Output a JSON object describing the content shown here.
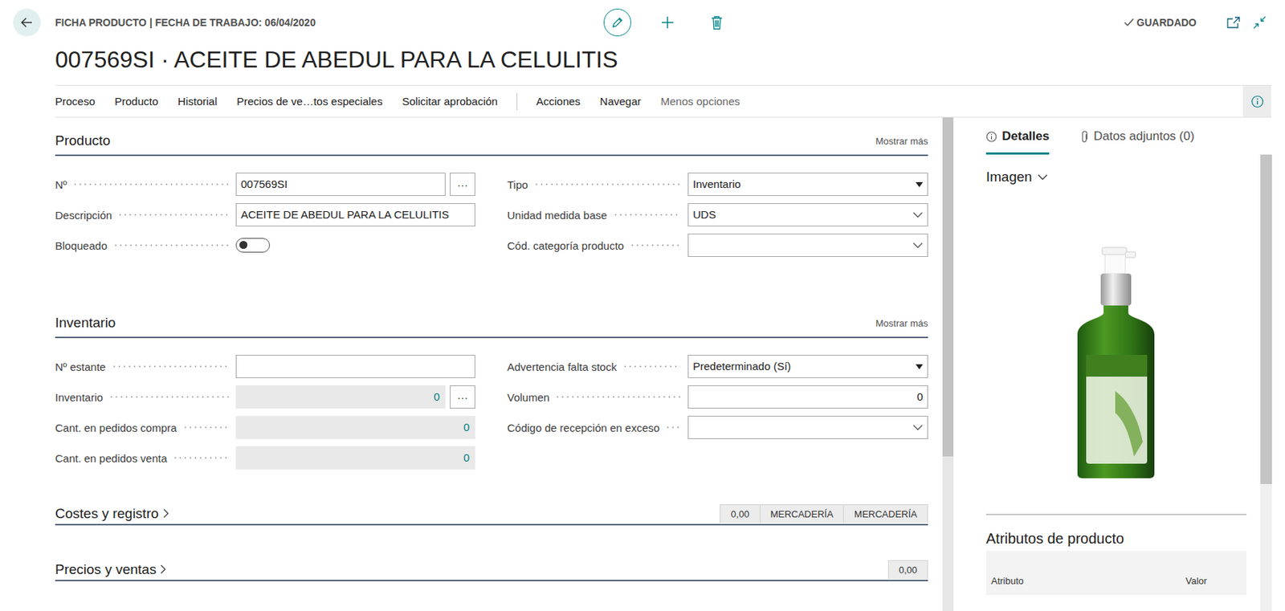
{
  "header": {
    "breadcrumb": "FICHA PRODUCTO | FECHA DE TRABAJO: 06/04/2020",
    "status": "GUARDADO"
  },
  "title": "007569SI · ACEITE DE ABEDUL PARA LA CELULITIS",
  "actions": [
    "Proceso",
    "Producto",
    "Historial",
    "Precios de ve…tos especiales",
    "Solicitar aprobación"
  ],
  "more_actions": [
    "Acciones",
    "Navegar"
  ],
  "less_options": "Menos opciones",
  "sections": [
    {
      "title": "Producto",
      "expanded": true,
      "show_more": "Mostrar más",
      "left": [
        {
          "label": "Nº",
          "kind": "lookup-text",
          "value": "007569SI",
          "button": "···"
        },
        {
          "label": "Descripción",
          "kind": "text",
          "value": "ACEITE DE ABEDUL PARA LA CELULITIS"
        },
        {
          "label": "Bloqueado",
          "kind": "toggle",
          "on": false
        }
      ],
      "right": [
        {
          "label": "Tipo",
          "kind": "select",
          "value": "Inventario"
        },
        {
          "label": "Unidad medida base",
          "kind": "combo",
          "value": "UDS"
        },
        {
          "label": "Cód. categoría producto",
          "kind": "combo",
          "value": ""
        }
      ]
    },
    {
      "title": "Inventario",
      "expanded": true,
      "show_more": "Mostrar más",
      "left": [
        {
          "label": "Nº estante",
          "kind": "text",
          "value": ""
        },
        {
          "label": "Inventario",
          "kind": "flowfield-lookup",
          "value": "0",
          "button": "···"
        },
        {
          "label": "Cant. en pedidos compra",
          "kind": "flowfield",
          "value": "0"
        },
        {
          "label": "Cant. en pedidos venta",
          "kind": "flowfield",
          "value": "0"
        }
      ],
      "right": [
        {
          "label": "Advertencia falta stock",
          "kind": "select",
          "value": "Predeterminado (Sí)"
        },
        {
          "label": "Volumen",
          "kind": "number",
          "value": "0"
        },
        {
          "label": "Código de recepción en exceso",
          "kind": "combo",
          "value": ""
        }
      ]
    },
    {
      "title": "Costes y registro",
      "expanded": false,
      "summary": [
        "0,00",
        "MERCADERÍA",
        "MERCADERÍA"
      ]
    },
    {
      "title": "Precios y ventas",
      "expanded": false,
      "summary": [
        "0,00"
      ]
    }
  ],
  "factbox": {
    "tabs": [
      {
        "label": "Detalles",
        "selected": true
      },
      {
        "label": "Datos adjuntos (0)",
        "selected": false
      }
    ],
    "image": {
      "title": "Imagen",
      "expanded": true
    },
    "attributes": {
      "title": "Atributos de producto",
      "columns": [
        "Atributo",
        "Valor"
      ]
    }
  }
}
